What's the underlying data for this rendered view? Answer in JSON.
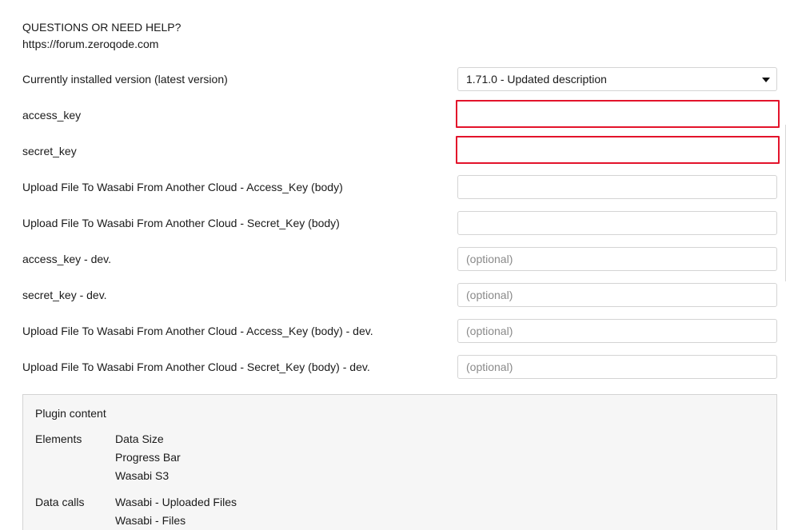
{
  "help": {
    "title": "QUESTIONS OR NEED HELP?",
    "link": "https://forum.zeroqode.com"
  },
  "version": {
    "label": "Currently installed version (latest version)",
    "selected": "1.71.0 - Updated description"
  },
  "fields": [
    {
      "label": "access_key",
      "value": "",
      "placeholder": "",
      "state": "error"
    },
    {
      "label": "secret_key",
      "value": "",
      "placeholder": "",
      "state": "error"
    },
    {
      "label": "Upload File To Wasabi From Another Cloud - Access_Key (body)",
      "value": "",
      "placeholder": ""
    },
    {
      "label": "Upload File To Wasabi From Another Cloud - Secret_Key (body)",
      "value": "",
      "placeholder": ""
    },
    {
      "label": "access_key - dev.",
      "value": "",
      "placeholder": "(optional)"
    },
    {
      "label": "secret_key - dev.",
      "value": "",
      "placeholder": "(optional)"
    },
    {
      "label": "Upload File To Wasabi From Another Cloud - Access_Key (body) - dev.",
      "value": "",
      "placeholder": "(optional)"
    },
    {
      "label": "Upload File To Wasabi From Another Cloud - Secret_Key (body) - dev.",
      "value": "",
      "placeholder": "(optional)"
    }
  ],
  "plugin_content": {
    "title": "Plugin content",
    "elements_label": "Elements",
    "elements": [
      "Data Size",
      "Progress Bar",
      "Wasabi S3"
    ],
    "data_calls_label": "Data calls",
    "data_calls": [
      "Wasabi - Uploaded Files",
      "Wasabi - Files"
    ]
  },
  "colors": {
    "error_border": "#e3132b",
    "field_border": "#d4d4d4",
    "panel_background": "#f6f6f6"
  },
  "icons": {
    "dropdown": "caret-down-icon"
  }
}
